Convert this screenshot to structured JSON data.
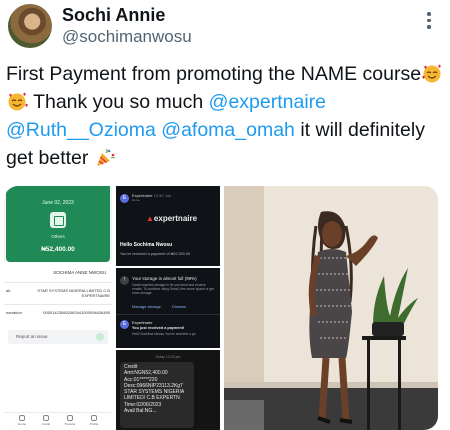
{
  "tweet": {
    "display_name": "Sochi Annie",
    "handle": "@sochimanwosu",
    "text_part1": "First Payment from promoting the NAME course",
    "text_part2": " Thank you so much ",
    "mention1": "@expertnaire",
    "mention2": "@Ruth__Ozioma",
    "mention3": "@afoma_omah",
    "text_part3": " it will definitely get better",
    "emojis": [
      "smiling-face-with-hearts",
      "smiling-face-with-hearts",
      "party-popper"
    ]
  },
  "media": {
    "app_screenshot": {
      "date": "June 02, 2023",
      "category": "Others",
      "amount": "₦52,400.00",
      "recipient": "SOCHIMA ANNE NWOSU",
      "rows": [
        {
          "label": "ab",
          "value": "STAR SYSTEMS NIGERIA LIMITED C.B EXPERTNAIRE"
        },
        {
          "label": "narration",
          "value": "000014230602063441000094636495"
        }
      ],
      "report": "Report an issue",
      "nav": [
        "Home",
        "Cards",
        "Transfer",
        "Profile"
      ]
    },
    "gmail_screenshot": {
      "avatar": "E",
      "sender": "Expertnaire",
      "time": "12:40 Jun",
      "subject": "to me",
      "logo_text": "expertnaire",
      "greeting": "Hello Sochima Nwosu",
      "body": "You've received a payment of ₦52,300.00"
    },
    "storage_screenshot": {
      "title": "Your storage is almost full (99%)",
      "body": "Gmail requires storage to let you send and receive emails. To continue using Gmail, free some space or get more storage.",
      "action1": "Manage storage",
      "action2": "Dismiss",
      "avatar": "E",
      "sender": "Expertnaire",
      "subject": "You just received a payment!",
      "preview": "Hello Sochima Nwosu You've received a pa"
    },
    "sms_screenshot": {
      "time": "Today 12:23 pm",
      "text": "Credit\nAmt:NGN52,400.00\nAcc:01*****220\nDesc:0966NIP23113.2Kg7 STAR SYSTEMS NIGERIA LIMITED/ C.B EXPERTN\nTime:02/06/2023\nAvail Bal:NG..."
    },
    "photo_alt": "woman in sequin dress standing by a plant"
  },
  "colors": {
    "text": "#0f1419",
    "secondary": "#536471",
    "link": "#1d9bf0",
    "bank_green": "#1f8a55"
  },
  "icons": [
    "more-vertical-icon",
    "shield-logo-icon"
  ]
}
